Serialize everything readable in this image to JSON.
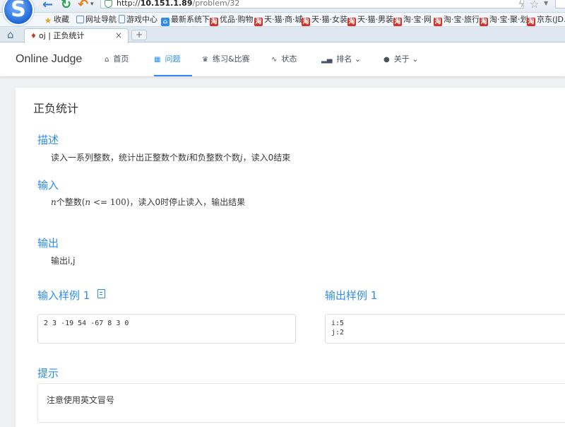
{
  "browser": {
    "url_scheme": "http://",
    "url_host": "10.151.1.89",
    "url_path": "/problem/32",
    "bookmarks": [
      {
        "label": "收藏",
        "icon": "star-icon"
      },
      {
        "label": "网址导航",
        "icon": "globe-icon"
      },
      {
        "label": "游戏中心",
        "icon": "page-icon"
      },
      {
        "label": "最新系统下",
        "icon": "home-icon"
      },
      {
        "label": "优品·购物",
        "icon": "taobao-icon"
      },
      {
        "label": "天·猫·商·城",
        "icon": "taobao-icon"
      },
      {
        "label": "天·猫·女装",
        "icon": "taobao-icon"
      },
      {
        "label": "天·猫·男装",
        "icon": "taobao-icon"
      },
      {
        "label": "淘·宝·网",
        "icon": "taobao-icon"
      },
      {
        "label": "淘·宝·旅行",
        "icon": "taobao-icon"
      },
      {
        "label": "淘·宝·聚·划",
        "icon": "taobao-icon"
      },
      {
        "label": "京东(JD.C",
        "icon": "taobao-icon"
      }
    ],
    "tab": {
      "title": "oj | 正负统计"
    }
  },
  "header": {
    "brand": "Online Judge",
    "nav": {
      "home": "首页",
      "problem": "问题",
      "contest": "练习&比赛",
      "status": "状态",
      "rank": "排名",
      "about": "关于"
    },
    "active": "problem",
    "accent_color": "#2d8cf0"
  },
  "problem": {
    "title": "正负统计",
    "description_title": "描述",
    "description": {
      "part1": "读入一系列整数，统计出正整数个数",
      "var_i": "i",
      "part2": "和负整数个数",
      "var_j": "j",
      "part3": "，读入0结束"
    },
    "input_title": "输入",
    "input": {
      "var_n": "n",
      "part1": "个整数(",
      "cond": "<= 100",
      "part2": ")，读入0时停止读入，输出结果"
    },
    "output_title": "输出",
    "output": "输出i,j",
    "sample_input_title": "输入样例 1",
    "sample_output_title": "输出样例 1",
    "sample_input": "2 3 -19 54 -67 8 3 0",
    "sample_output": "i:5\nj:2",
    "hint_title": "提示",
    "hint": "注意使用英文冒号"
  }
}
